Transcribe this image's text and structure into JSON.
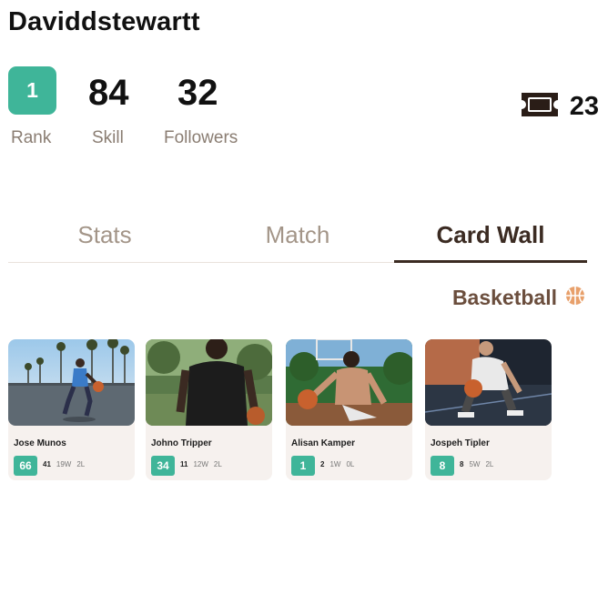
{
  "profile": {
    "username": "Daviddstewartt",
    "rank": {
      "value": "1",
      "label": "Rank"
    },
    "skill": {
      "value": "84",
      "label": "Skill"
    },
    "followers": {
      "value": "32",
      "label": "Followers"
    },
    "tickets": {
      "icon": "ticket-icon",
      "count": "23"
    }
  },
  "tabs": [
    {
      "label": "Stats",
      "active": false
    },
    {
      "label": "Match",
      "active": false
    },
    {
      "label": "Card Wall",
      "active": true
    }
  ],
  "filter": {
    "sport": "Basketball",
    "icon": "basketball-icon"
  },
  "cards": [
    {
      "name": "Jose Munos",
      "score": "66",
      "games": "41",
      "wins": "19W",
      "losses": "2L"
    },
    {
      "name": "Johno Tripper",
      "score": "34",
      "games": "11",
      "wins": "12W",
      "losses": "2L"
    },
    {
      "name": "Alisan Kamper",
      "score": "1",
      "games": "2",
      "wins": "1W",
      "losses": "0L"
    },
    {
      "name": "Jospeh Tipler",
      "score": "8",
      "games": "8",
      "wins": "5W",
      "losses": "2L"
    }
  ],
  "colors": {
    "accent": "#3fb599",
    "brown": "#3b2b22",
    "muted": "#a39588"
  }
}
